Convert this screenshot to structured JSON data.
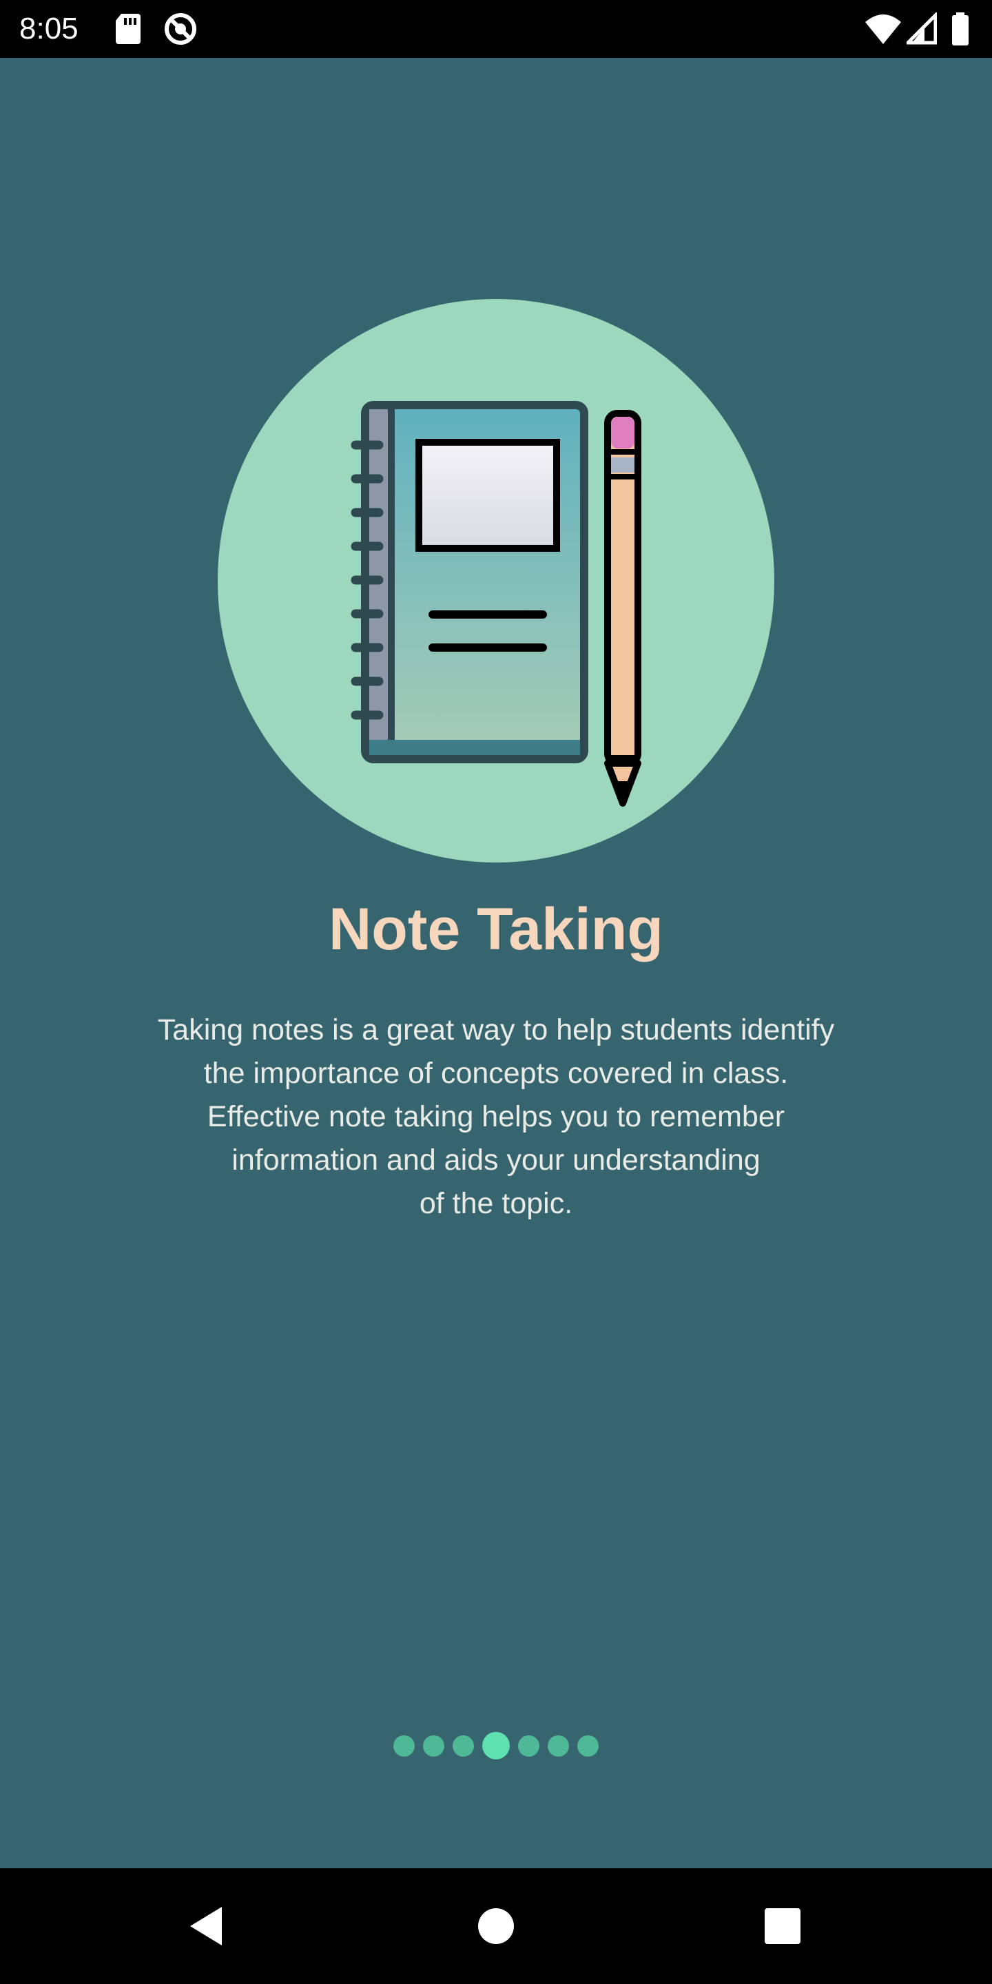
{
  "status_bar": {
    "time": "8:05",
    "icons": [
      "sd-card-icon",
      "vpn-icon",
      "wifi-icon",
      "cell-signal-icon",
      "battery-icon"
    ]
  },
  "onboarding": {
    "illustration": "notebook-pencil-icon",
    "title": "Note Taking",
    "description_lines": [
      "Taking notes is a great way to help students identify",
      "the importance of concepts covered in class.",
      "Effective note taking helps you to remember",
      "information and aids your understanding",
      "of the topic."
    ],
    "page_indicator": {
      "total": 7,
      "active_index": 3
    }
  },
  "nav_bar": {
    "buttons": [
      "back-icon",
      "home-icon",
      "recents-icon"
    ]
  },
  "colors": {
    "background": "#37656f",
    "circle": "#9bd8bd",
    "title": "#f6d6bc",
    "body_text": "#e9ece6",
    "dot": "#4fb896",
    "dot_active": "#5fe0b0"
  }
}
